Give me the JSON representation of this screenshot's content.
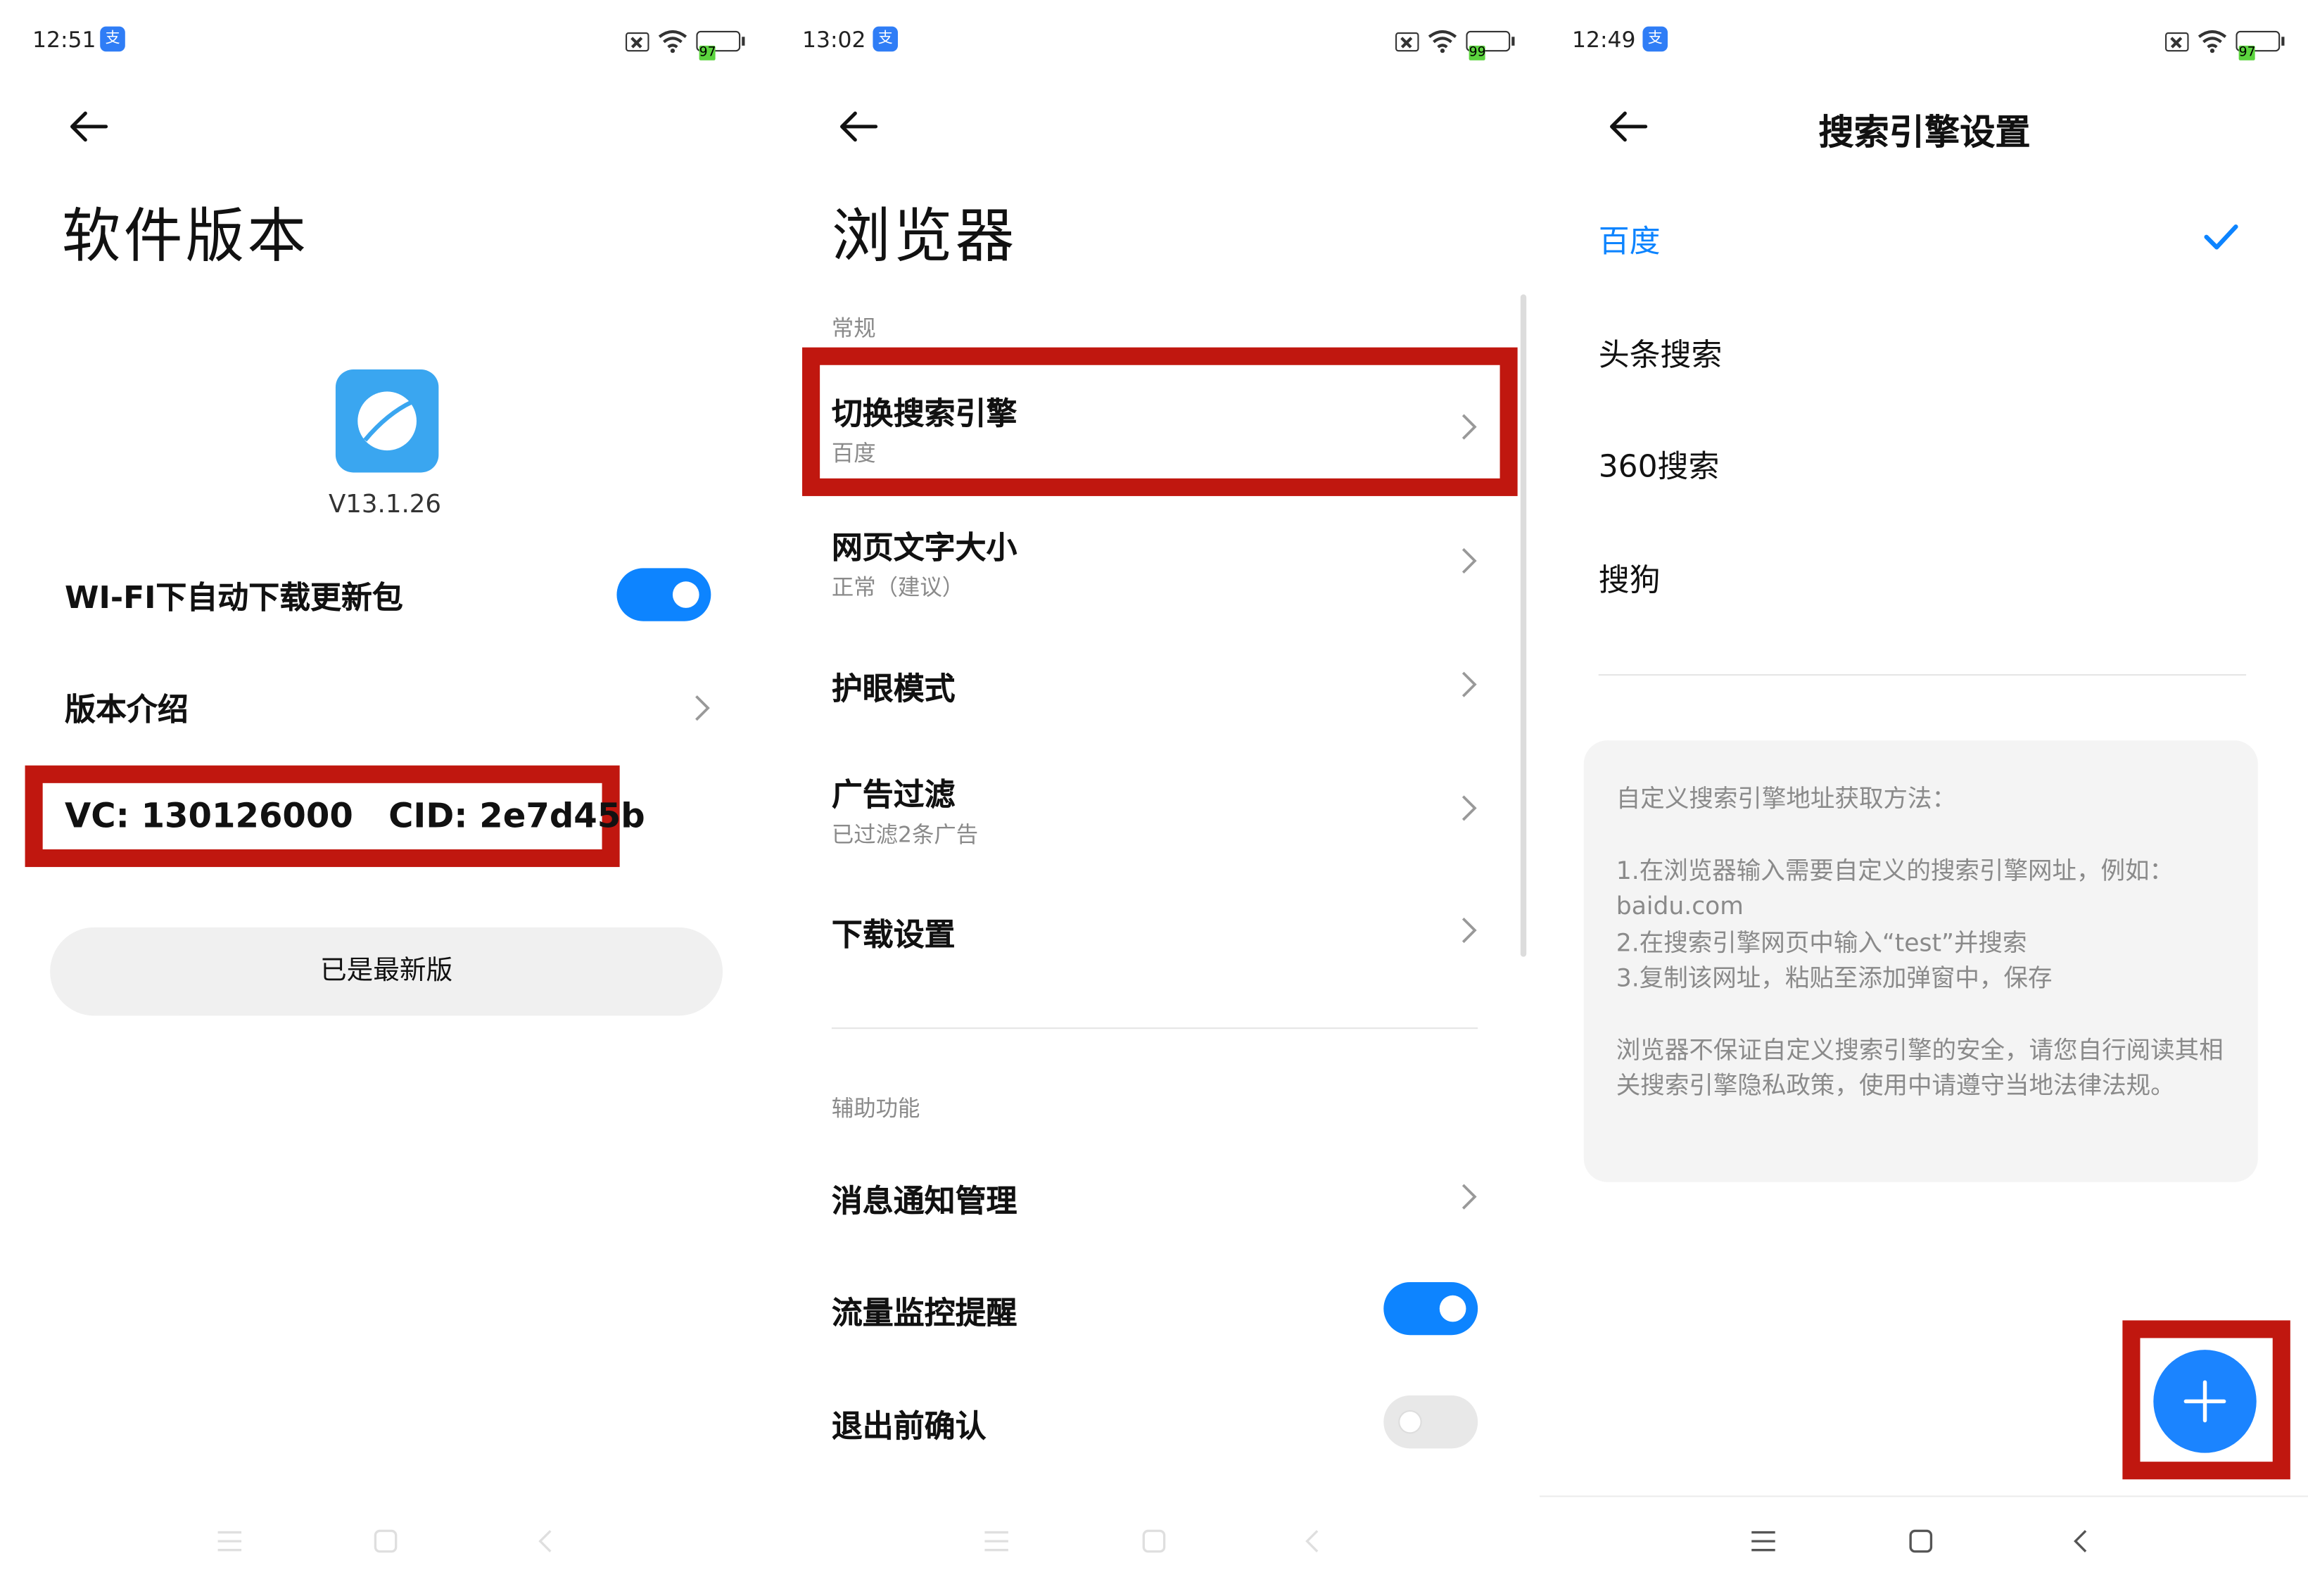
{
  "panel1": {
    "status": {
      "time": "12:51",
      "battery": "97"
    },
    "title": "软件版本",
    "version": "V13.1.26",
    "wifi_label": "WI-FI下自动下载更新包",
    "intro_label": "版本介绍",
    "vc_text": "VC: 130126000   CID: 2e7d45b",
    "latest_button": "已是最新版"
  },
  "panel2": {
    "status": {
      "time": "13:02",
      "battery": "99"
    },
    "title": "浏览器",
    "section_general": "常规",
    "items": [
      {
        "label": "切换搜索引擎",
        "sub": "百度"
      },
      {
        "label": "网页文字大小",
        "sub": "正常（建议）"
      },
      {
        "label": "护眼模式",
        "sub": ""
      },
      {
        "label": "广告过滤",
        "sub": "已过滤2条广告"
      },
      {
        "label": "下载设置",
        "sub": ""
      }
    ],
    "section_assist": "辅助功能",
    "assist_items": [
      {
        "label": "消息通知管理"
      },
      {
        "label": "流量监控提醒"
      },
      {
        "label": "退出前确认"
      }
    ]
  },
  "panel3": {
    "status": {
      "time": "12:49",
      "battery": "97"
    },
    "title": "搜索引擎设置",
    "engines": [
      "百度",
      "头条搜索",
      "360搜索",
      "搜狗"
    ],
    "selected": "百度",
    "info": {
      "heading": "自定义搜索引擎地址获取方法：",
      "step1": "1.在浏览器输入需要自定义的搜索引擎网址，例如：baidu.com",
      "step2": "2.在搜索引擎网页中输入“test”并搜索",
      "step3": "3.复制该网址，粘贴至添加弹窗中，保存",
      "disclaimer": "浏览器不保证自定义搜索引擎的安全，请您自行阅读其相关搜索引擎隐私政策，使用中请遵守当地法律法规。"
    }
  },
  "colors": {
    "accent": "#0d84ff",
    "highlight": "#c0170f"
  },
  "icons": [
    "back-arrow-icon",
    "chevron-right-icon",
    "check-icon",
    "plus-icon",
    "wifi-icon",
    "battery-icon",
    "sim-off-icon",
    "menu-icon",
    "home-icon",
    "back-nav-icon"
  ]
}
